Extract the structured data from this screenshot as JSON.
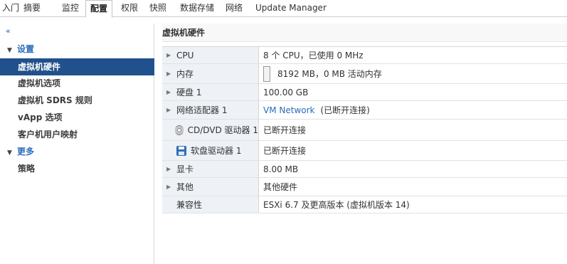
{
  "tabs": [
    {
      "label": "入门",
      "active": false
    },
    {
      "label": "摘要",
      "active": false
    },
    {
      "label": "监控",
      "active": false
    },
    {
      "label": "配置",
      "active": true
    },
    {
      "label": "权限",
      "active": false
    },
    {
      "label": "快照",
      "active": false
    },
    {
      "label": "数据存储",
      "active": false
    },
    {
      "label": "网络",
      "active": false
    },
    {
      "label": "Update Manager",
      "active": false
    }
  ],
  "sidebar": {
    "collapse_glyph": "«",
    "groups": [
      {
        "label": "设置",
        "items": [
          {
            "label": "虚拟机硬件",
            "selected": true
          },
          {
            "label": "虚拟机选项",
            "selected": false
          },
          {
            "label": "虚拟机 SDRS 规则",
            "selected": false
          },
          {
            "label": "vApp 选项",
            "selected": false
          },
          {
            "label": "客户机用户映射",
            "selected": false
          }
        ]
      },
      {
        "label": "更多",
        "items": [
          {
            "label": "策略",
            "selected": false
          }
        ]
      }
    ]
  },
  "main": {
    "title": "虚拟机硬件",
    "rows": [
      {
        "label": "CPU",
        "value": "8 个 CPU，已使用 0 MHz",
        "expandable": true,
        "icon": null
      },
      {
        "label": "内存",
        "value": "8192 MB，0 MB 活动内存",
        "expandable": true,
        "icon": "memory-gauge"
      },
      {
        "label": "硬盘 1",
        "value": "100.00 GB",
        "expandable": true,
        "icon": null
      },
      {
        "label": "网络适配器 1",
        "value_link": "VM Network",
        "value_suffix": "(已断开连接)",
        "expandable": true,
        "icon": null
      },
      {
        "label": "CD/DVD 驱动器 1",
        "value": "已断开连接",
        "expandable": false,
        "icon": "cd-dvd-icon"
      },
      {
        "label": "软盘驱动器 1",
        "value": "已断开连接",
        "expandable": false,
        "icon": "floppy-icon"
      },
      {
        "label": "显卡",
        "value": "8.00 MB",
        "expandable": true,
        "icon": null
      },
      {
        "label": "其他",
        "value": "其他硬件",
        "expandable": true,
        "icon": null
      },
      {
        "label": "兼容性",
        "value": "ESXi 6.7 及更高版本 (虚拟机版本 14)",
        "expandable": false,
        "icon": null
      }
    ]
  },
  "colors": {
    "selected_bg": "#20518c",
    "accent_blue": "#2a6cbd",
    "label_cell_bg": "#eef1f6"
  }
}
